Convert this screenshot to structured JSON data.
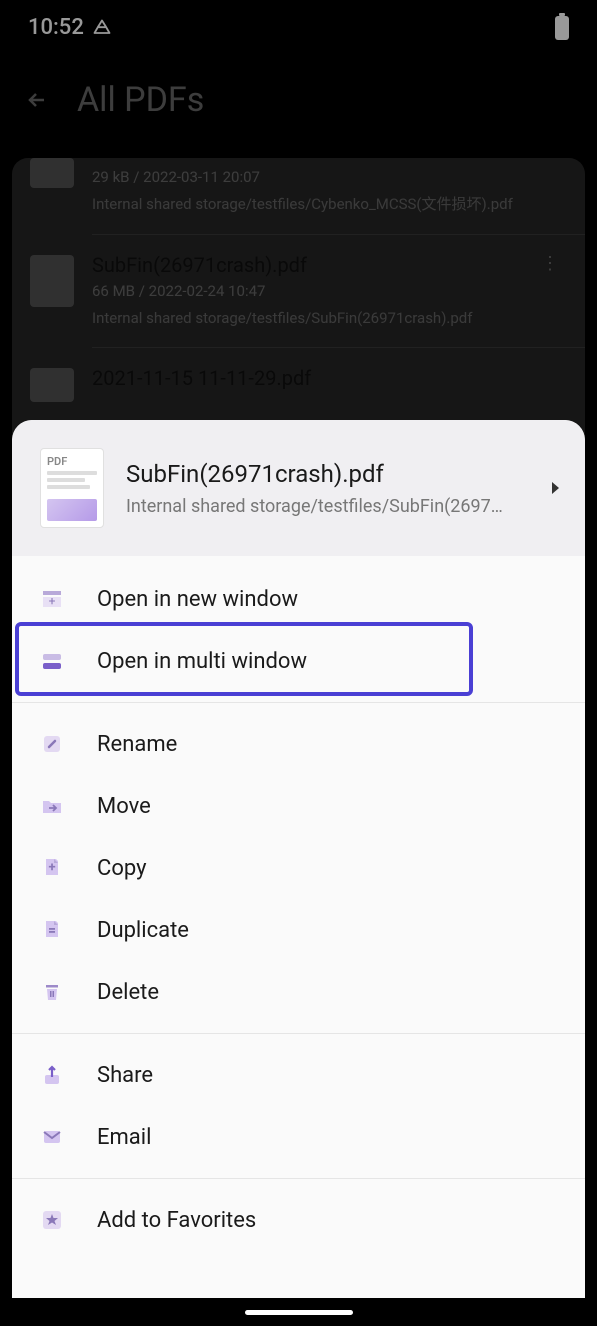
{
  "status": {
    "time": "10:52"
  },
  "header": {
    "title": "All PDFs"
  },
  "bg_files": [
    {
      "title": "",
      "meta": "29 kB / 2022-03-11 20:07",
      "path": "Internal shared storage/testfiles/Cybenko_MCSS(文件损坏).pdf"
    },
    {
      "title": "SubFin(26971crash).pdf",
      "meta": "66 MB / 2022-02-24 10:47",
      "path": "Internal shared storage/testfiles/SubFin(26971crash).pdf"
    },
    {
      "title": "2021-11-15 11-11-29.pdf",
      "meta": "",
      "path": ""
    }
  ],
  "sheet": {
    "title": "SubFin(26971crash).pdf",
    "path": "Internal shared storage/testfiles/SubFin(2697…"
  },
  "menu": {
    "open_new_window": "Open in new window",
    "open_multi_window": "Open in multi window",
    "rename": "Rename",
    "move": "Move",
    "copy": "Copy",
    "duplicate": "Duplicate",
    "delete": "Delete",
    "share": "Share",
    "email": "Email",
    "add_favorites": "Add to Favorites"
  }
}
